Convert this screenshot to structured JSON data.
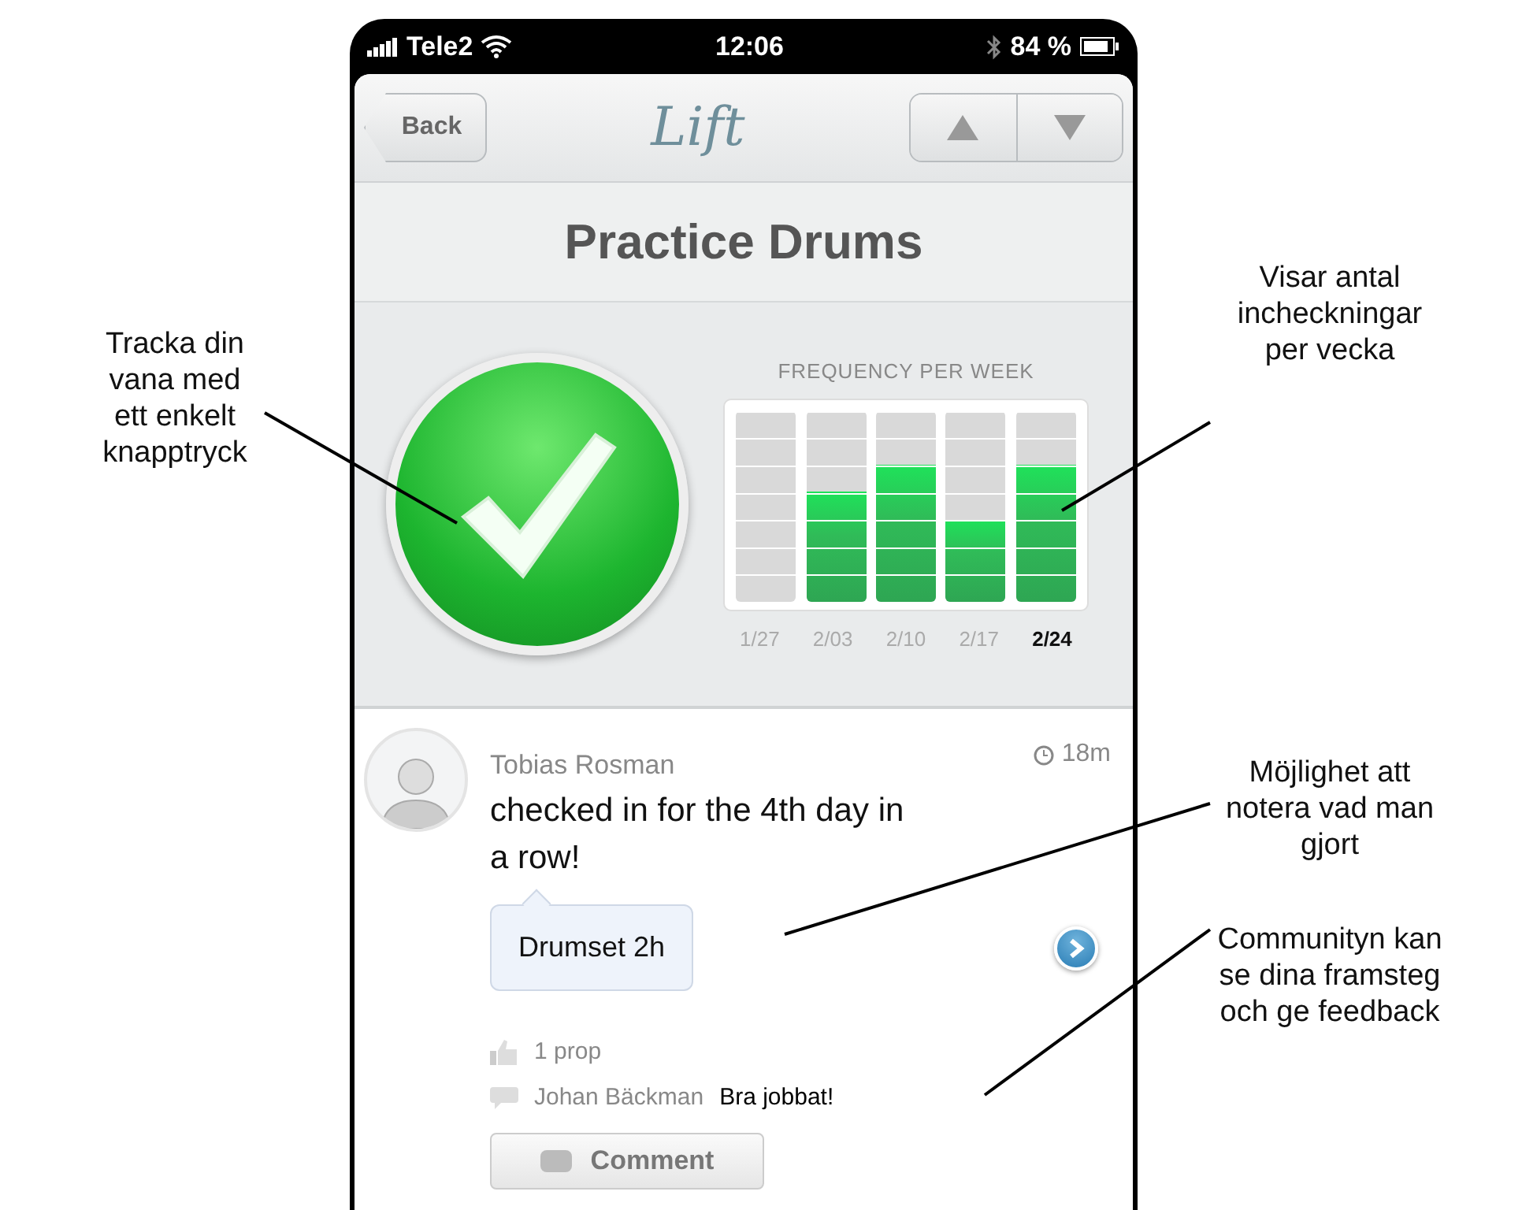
{
  "status_bar": {
    "carrier": "Tele2",
    "time": "12:06",
    "battery": "84 %"
  },
  "nav": {
    "back": "Back",
    "logo": "Lift"
  },
  "habit_title": "Practice Drums",
  "check_in": {
    "checked": true
  },
  "frequency": {
    "title": "FREQUENCY PER WEEK",
    "weeks": [
      {
        "label": "1/27",
        "level": 0,
        "selected": false
      },
      {
        "label": "2/03",
        "level": 0.571,
        "selected": false
      },
      {
        "label": "2/10",
        "level": 0.714,
        "selected": false
      },
      {
        "label": "2/17",
        "level": 0.429,
        "selected": false
      },
      {
        "label": "2/24",
        "level": 0.714,
        "selected": true
      }
    ]
  },
  "feed": [
    {
      "author": "Tobias Rosman",
      "time": "18m",
      "message": "checked in for the 4th day in a row!",
      "note": "Drumset 2h",
      "props": "1 prop",
      "comments": [
        {
          "author": "Johan Bäckman",
          "text": "Bra jobbat!"
        }
      ],
      "comment_button": "Comment"
    }
  ],
  "annotations": [
    {
      "text": "Tracka din\nvana med\nett enkelt\nknapptryck"
    },
    {
      "text": "Visar antal\nincheckningar\nper vecka"
    },
    {
      "text": "Möjlighet att\nnotera vad man\ngjort"
    },
    {
      "text": "Communityn kan\nse dina framsteg\noch ge feedback"
    }
  ]
}
